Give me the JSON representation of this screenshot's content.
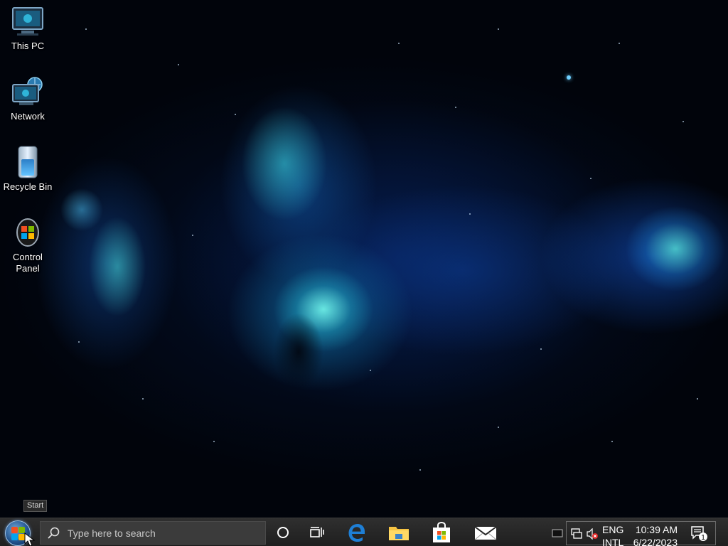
{
  "desktop": {
    "icons": [
      {
        "label": "This PC",
        "icon": "computer-icon"
      },
      {
        "label": "Network",
        "icon": "network-icon"
      },
      {
        "label": "Recycle Bin",
        "icon": "recycle-bin-icon"
      },
      {
        "label": "Control Panel",
        "icon": "control-panel-icon"
      }
    ]
  },
  "tooltip": {
    "start": "Start"
  },
  "taskbar": {
    "search_placeholder": "Type here to search",
    "pinned": [
      "cortana-icon",
      "task-view-icon",
      "edge-icon",
      "file-explorer-icon",
      "store-icon",
      "mail-icon"
    ],
    "tray": {
      "language_line1": "ENG",
      "language_line2": "INTL",
      "time": "10:39 AM",
      "date": "6/22/2023",
      "notification_count": "1"
    }
  },
  "colors": {
    "taskbar_bg": "#252525",
    "edge_blue": "#1e7fd6",
    "folder_yellow": "#f6c443",
    "desktop_text": "#ffffff"
  }
}
